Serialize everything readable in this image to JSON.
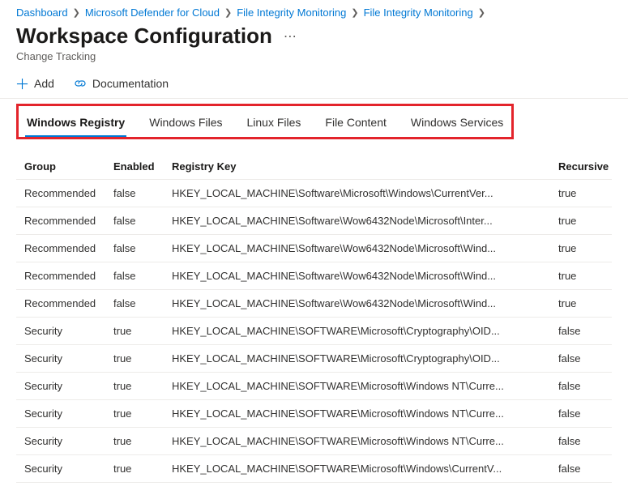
{
  "breadcrumb": {
    "items": [
      "Dashboard",
      "Microsoft Defender for Cloud",
      "File Integrity Monitoring",
      "File Integrity Monitoring"
    ]
  },
  "header": {
    "title": "Workspace Configuration",
    "subtitle": "Change Tracking"
  },
  "toolbar": {
    "add": "Add",
    "docs": "Documentation"
  },
  "tabs": {
    "items": [
      "Windows Registry",
      "Windows Files",
      "Linux Files",
      "File Content",
      "Windows Services"
    ],
    "active_index": 0
  },
  "table": {
    "columns": {
      "group": "Group",
      "enabled": "Enabled",
      "regkey": "Registry Key",
      "recursive": "Recursive"
    },
    "rows": [
      {
        "group": "Recommended",
        "enabled": "false",
        "regkey": "HKEY_LOCAL_MACHINE\\Software\\Microsoft\\Windows\\CurrentVer...",
        "recursive": "true"
      },
      {
        "group": "Recommended",
        "enabled": "false",
        "regkey": "HKEY_LOCAL_MACHINE\\Software\\Wow6432Node\\Microsoft\\Inter...",
        "recursive": "true"
      },
      {
        "group": "Recommended",
        "enabled": "false",
        "regkey": "HKEY_LOCAL_MACHINE\\Software\\Wow6432Node\\Microsoft\\Wind...",
        "recursive": "true"
      },
      {
        "group": "Recommended",
        "enabled": "false",
        "regkey": "HKEY_LOCAL_MACHINE\\Software\\Wow6432Node\\Microsoft\\Wind...",
        "recursive": "true"
      },
      {
        "group": "Recommended",
        "enabled": "false",
        "regkey": "HKEY_LOCAL_MACHINE\\Software\\Wow6432Node\\Microsoft\\Wind...",
        "recursive": "true"
      },
      {
        "group": "Security",
        "enabled": "true",
        "regkey": "HKEY_LOCAL_MACHINE\\SOFTWARE\\Microsoft\\Cryptography\\OID...",
        "recursive": "false"
      },
      {
        "group": "Security",
        "enabled": "true",
        "regkey": "HKEY_LOCAL_MACHINE\\SOFTWARE\\Microsoft\\Cryptography\\OID...",
        "recursive": "false"
      },
      {
        "group": "Security",
        "enabled": "true",
        "regkey": "HKEY_LOCAL_MACHINE\\SOFTWARE\\Microsoft\\Windows NT\\Curre...",
        "recursive": "false"
      },
      {
        "group": "Security",
        "enabled": "true",
        "regkey": "HKEY_LOCAL_MACHINE\\SOFTWARE\\Microsoft\\Windows NT\\Curre...",
        "recursive": "false"
      },
      {
        "group": "Security",
        "enabled": "true",
        "regkey": "HKEY_LOCAL_MACHINE\\SOFTWARE\\Microsoft\\Windows NT\\Curre...",
        "recursive": "false"
      },
      {
        "group": "Security",
        "enabled": "true",
        "regkey": "HKEY_LOCAL_MACHINE\\SOFTWARE\\Microsoft\\Windows\\CurrentV...",
        "recursive": "false"
      }
    ]
  }
}
